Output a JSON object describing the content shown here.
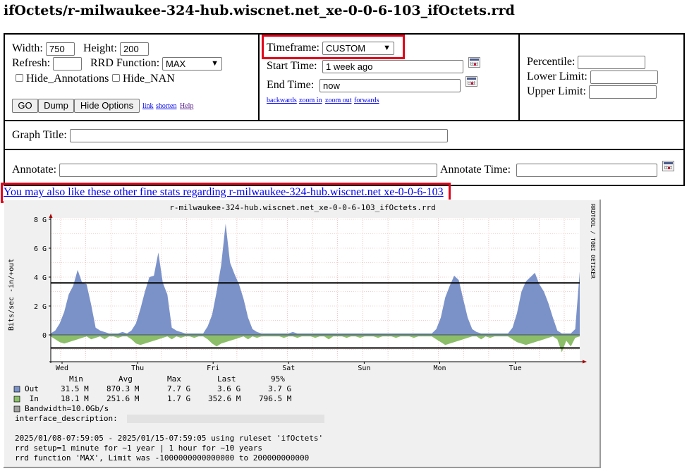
{
  "page_title": "ifOctets/r-milwaukee-324-hub.wiscnet.net_xe-0-0-6-103_ifOctets.rrd",
  "options": {
    "width_label": "Width:",
    "width_value": "750",
    "height_label": "Height:",
    "height_value": "200",
    "refresh_label": "Refresh:",
    "refresh_value": "",
    "rrd_function_label": "RRD Function:",
    "rrd_function_value": "MAX",
    "hide_annotations_label": "Hide_Annotations",
    "hide_nan_label": "Hide_NAN",
    "go_label": "GO",
    "dump_label": "Dump",
    "hide_options_label": "Hide Options",
    "link_label": "link",
    "shorten_label": "shorten",
    "help_label": "Help"
  },
  "timeframe": {
    "timeframe_label": "Timeframe:",
    "timeframe_value": "CUSTOM",
    "start_label": "Start Time:",
    "start_value": "1 week ago",
    "end_label": "End Time:",
    "end_value": "now",
    "backwards": "backwards",
    "zoom_in": "zoom in",
    "zoom_out": "zoom out",
    "forwards": "forwards"
  },
  "limits": {
    "percentile_label": "Percentile:",
    "lower_label": "Lower Limit:",
    "upper_label": "Upper Limit:"
  },
  "graph_title_label": "Graph Title:",
  "annotate_label": "Annotate:",
  "annotate_time_label": "Annotate Time:",
  "other_stats_link": "You may also like these other fine stats regarding r-milwaukee-324-hub.wiscnet.net xe-0-0-6-103",
  "graph": {
    "title": "r-milwaukee-324-hub.wiscnet.net_xe-0-0-6-103_ifOctets.rrd",
    "watermark": "RRDTOOL / TOBI OETIKER",
    "ylabel": "Bits/sec  -in/+out",
    "legend_header": {
      "min": "Min",
      "avg": "Avg",
      "max": "Max",
      "last": "Last",
      "p95": "95%"
    },
    "legend_rows": [
      {
        "name": "Out",
        "min": "31.5 M",
        "avg": "870.3 M",
        "max": "7.7 G",
        "last": "3.6 G",
        "p95": "3.7 G"
      },
      {
        "name": " In",
        "min": "18.1 M",
        "avg": "251.6 M",
        "max": "1.7 G",
        "last": "352.6 M",
        "p95": "796.5 M"
      }
    ],
    "bandwidth_line": "Bandwidth=10.0Gb/s",
    "interface_label": "interface_description:",
    "footer_lines": [
      "2025/01/08-07:59:05 - 2025/01/15-07:59:05 using ruleset 'ifOctets'",
      "rrd setup=1 minute for ~1 year | 1 hour for ~10 years",
      "rrd function 'MAX', Limit was -1000000000000000 to 200000000000"
    ],
    "colors": {
      "out": "#7b92c9",
      "in": "#8cbe6a",
      "bandwidth": "#a0a0a0",
      "grid": "#e8a0a0",
      "background": "#f0f0f0"
    }
  },
  "chart_data": {
    "type": "area",
    "title": "r-milwaukee-324-hub.wiscnet.net_xe-0-0-6-103_ifOctets.rrd",
    "ylabel": "Bits/sec  -in/+out",
    "y_ticks": [
      "8 G",
      "6 G",
      "4 G",
      "2 G",
      "0"
    ],
    "x_ticks": [
      "Wed",
      "Thu",
      "Fri",
      "Sat",
      "Sun",
      "Mon",
      "Tue"
    ],
    "ylim_gbps": [
      -1.0,
      8.0
    ],
    "series": [
      {
        "name": "Out",
        "values_gbps": [
          0.1,
          0.3,
          0.8,
          1.6,
          2.8,
          3.4,
          4.5,
          3.6,
          3.5,
          2.1,
          0.5,
          0.3,
          0.2,
          0.1,
          0.1,
          0.1,
          0.2,
          0.1,
          0.3,
          0.8,
          1.8,
          3.0,
          4.0,
          4.1,
          5.7,
          3.6,
          2.8,
          0.5,
          0.3,
          0.2,
          0.1,
          0.1,
          0.1,
          0.1,
          0.1,
          0.6,
          1.4,
          3.0,
          4.8,
          7.7,
          5.0,
          4.2,
          3.5,
          2.5,
          1.2,
          0.4,
          0.2,
          0.1,
          0.1,
          0.1,
          0.1,
          0.1,
          0.1,
          0.1,
          0.2,
          0.1,
          0.1,
          0.1,
          0.1,
          0.1,
          0.1,
          0.1,
          0.1,
          0.1,
          0.1,
          0.1,
          0.1,
          0.1,
          0.1,
          0.1,
          0.1,
          0.1,
          0.1,
          0.1,
          0.1,
          0.1,
          0.1,
          0.1,
          0.1,
          0.1,
          0.1,
          0.1,
          0.1,
          0.1,
          0.1,
          0.1,
          0.4,
          1.2,
          2.6,
          3.4,
          4.1,
          3.8,
          2.5,
          1.2,
          0.4,
          0.2,
          0.1,
          0.1,
          0.1,
          0.1,
          0.1,
          0.1,
          0.1,
          0.5,
          1.5,
          3.0,
          3.7,
          4.0,
          4.3,
          3.5,
          3.0,
          2.2,
          1.2,
          0.3,
          0.1,
          0.1,
          0.1,
          0.4,
          4.4
        ]
      },
      {
        "name": "In",
        "values_gbps": [
          -0.1,
          -0.3,
          -0.5,
          -0.6,
          -0.5,
          -0.4,
          -0.3,
          -0.2,
          -0.1,
          -0.3,
          -0.2,
          -0.1,
          -0.3,
          -0.1,
          -0.1,
          -0.2,
          -0.1,
          -0.1,
          -0.3,
          -0.6,
          -0.7,
          -0.6,
          -0.5,
          -0.4,
          -0.3,
          -0.2,
          -0.1,
          -0.3,
          -0.1,
          -0.2,
          -0.1,
          -0.1,
          -0.2,
          -0.1,
          -0.1,
          -0.3,
          -0.6,
          -0.8,
          -0.6,
          -0.5,
          -0.4,
          -0.3,
          -0.2,
          -0.1,
          -0.3,
          -0.1,
          -0.2,
          -0.1,
          -0.1,
          -0.1,
          -0.1,
          -0.1,
          -0.2,
          -0.1,
          -0.1,
          -0.2,
          -0.1,
          -0.1,
          -0.1,
          -0.2,
          -0.1,
          -0.1,
          -0.3,
          -0.1,
          -0.1,
          -0.1,
          -0.2,
          -0.1,
          -0.1,
          -0.2,
          -0.1,
          -0.1,
          -0.1,
          -0.2,
          -0.1,
          -0.1,
          -0.1,
          -0.2,
          -0.1,
          -0.1,
          -0.1,
          -0.2,
          -0.1,
          -0.1,
          -0.1,
          -0.1,
          -0.3,
          -0.5,
          -0.7,
          -0.6,
          -0.5,
          -0.4,
          -0.3,
          -0.2,
          -0.1,
          -0.1,
          -0.3,
          -0.1,
          -0.2,
          -0.1,
          -0.1,
          -0.1,
          -0.1,
          -0.3,
          -0.5,
          -0.6,
          -0.7,
          -0.6,
          -0.5,
          -0.4,
          -0.3,
          -0.2,
          -0.1,
          -0.3,
          -1.2,
          -0.4,
          -0.8,
          -0.2,
          -0.1
        ]
      }
    ],
    "hrules_gbps": [
      3.6,
      -0.9
    ],
    "grid": true
  }
}
